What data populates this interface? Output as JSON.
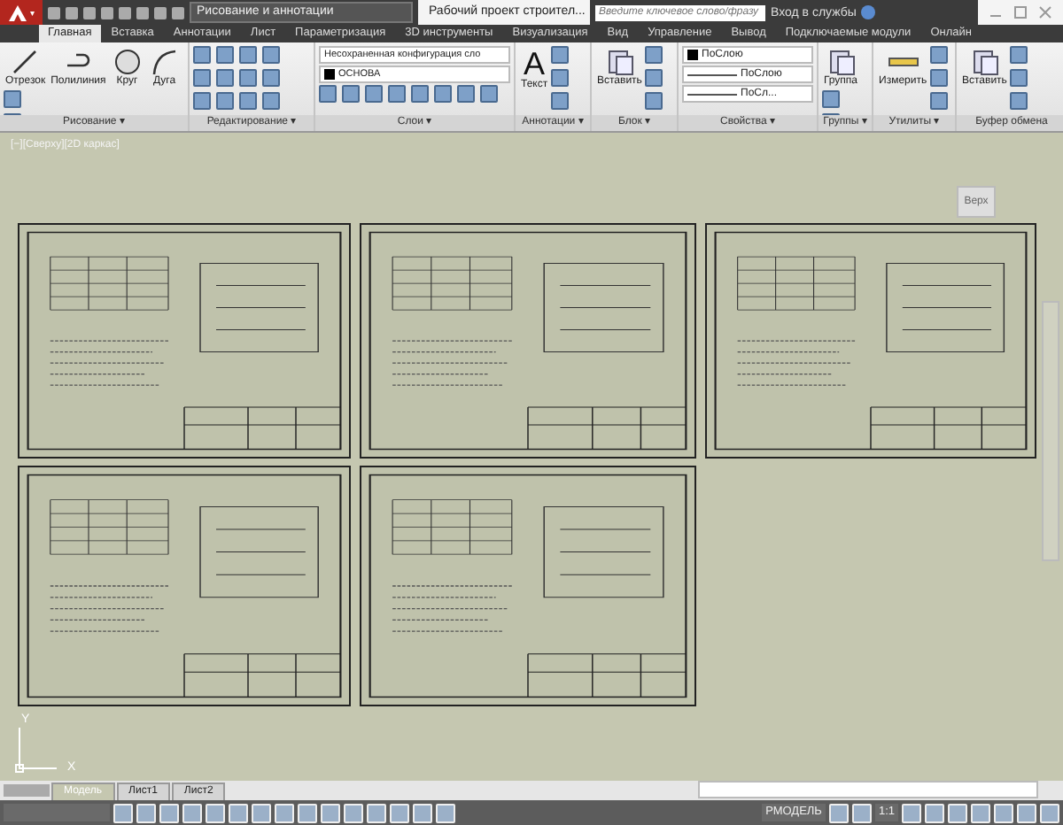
{
  "title_bar": {
    "app_menu": "▾",
    "workspace": "Рисование и аннотации",
    "document_title": "Рабочий проект строител...",
    "search": {
      "placeholder": "Введите ключевое слово/фразу"
    },
    "sign_in": "Вход в службы"
  },
  "ribbon_tabs": [
    {
      "label": "Главная",
      "selected": true
    },
    {
      "label": "Вставка",
      "selected": false
    },
    {
      "label": "Аннотации",
      "selected": false
    },
    {
      "label": "Лист",
      "selected": false
    },
    {
      "label": "Параметризация",
      "selected": false
    },
    {
      "label": "3D инструменты",
      "selected": false
    },
    {
      "label": "Визуализация",
      "selected": false
    },
    {
      "label": "Вид",
      "selected": false
    },
    {
      "label": "Управление",
      "selected": false
    },
    {
      "label": "Вывод",
      "selected": false
    },
    {
      "label": "Подключаемые модули",
      "selected": false
    },
    {
      "label": "Онлайн",
      "selected": false
    }
  ],
  "panels": [
    {
      "name": "Рисование ▾",
      "items": [
        {
          "kind": "big",
          "label": "Отрезок"
        },
        {
          "kind": "big",
          "label": "Полилиния"
        },
        {
          "kind": "big",
          "label": "Круг"
        },
        {
          "kind": "big",
          "label": "Дуга"
        }
      ]
    },
    {
      "name": "Редактирование ▾"
    },
    {
      "name": "Слои ▾",
      "items": [
        {
          "kind": "dropdown",
          "label": "Несохраненная конфигурация сло"
        },
        {
          "kind": "layer",
          "label": "ОСНОВА"
        }
      ]
    },
    {
      "name": "Аннотации ▾",
      "items": [
        {
          "kind": "glyph",
          "glyph": "A",
          "label": "Текст"
        }
      ]
    },
    {
      "name": "Блок ▾",
      "items": [
        {
          "kind": "big",
          "label": "Вставить"
        }
      ]
    },
    {
      "name": "Свойства ▾",
      "items": [
        {
          "kind": "layer",
          "label": "ПоСлою"
        },
        {
          "kind": "line",
          "label": "ПоСлою"
        },
        {
          "kind": "line",
          "label": "ПоСл..."
        }
      ]
    },
    {
      "name": "Группы ▾",
      "items": [
        {
          "kind": "big",
          "label": "Группа"
        }
      ]
    },
    {
      "name": "Утилиты ▾",
      "items": [
        {
          "kind": "big",
          "label": "Измерить"
        }
      ]
    },
    {
      "name": "Буфер обмена",
      "items": [
        {
          "kind": "big",
          "label": "Вставить"
        }
      ]
    }
  ],
  "viewport": {
    "label": "[−][Сверху][2D каркас]",
    "viewcube": "Верх",
    "ucs": {
      "y": "Y",
      "x": "X"
    }
  },
  "layout_tabs": [
    {
      "label": "Модель",
      "selected": true
    },
    {
      "label": "Лист1",
      "selected": false
    },
    {
      "label": "Лист2",
      "selected": false
    }
  ],
  "status_bar": {
    "space": "РМОДЕЛЬ",
    "scale": "1:1"
  }
}
